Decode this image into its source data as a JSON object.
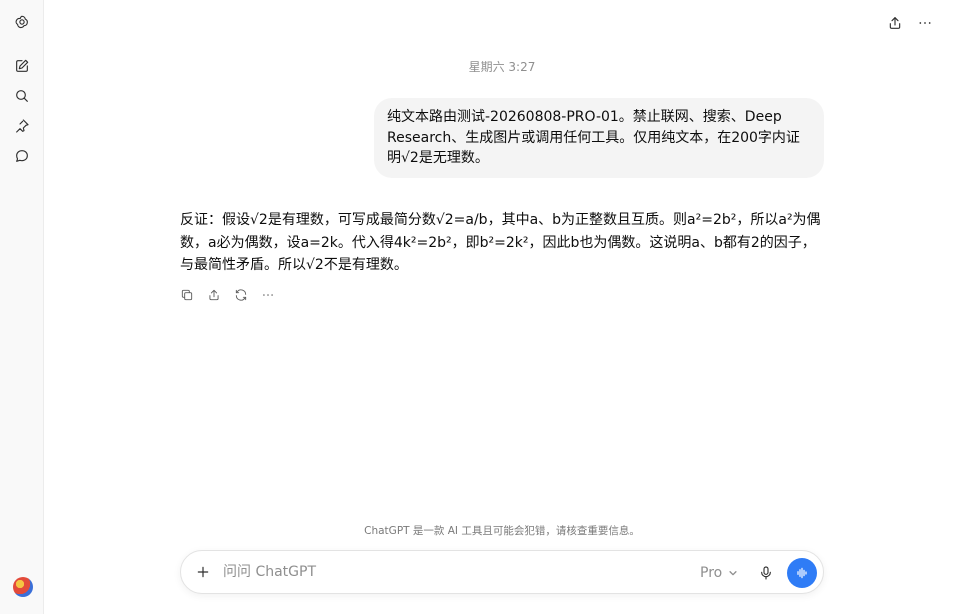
{
  "thread": {
    "timestamp": "星期六 3:27",
    "user_message": "纯文本路由测试-20260808-PRO-01。禁止联网、搜索、Deep Research、生成图片或调用任何工具。仅用纯文本，在200字内证明√2是无理数。",
    "assistant_message": "反证：假设√2是有理数，可写成最简分数√2=a/b，其中a、b为正整数且互质。则a²=2b²，所以a²为偶数，a必为偶数，设a=2k。代入得4k²=2b²，即b²=2k²，因此b也为偶数。这说明a、b都有2的因子，与最简性矛盾。所以√2不是有理数。"
  },
  "footer": {
    "disclaimer": "ChatGPT 是一款 AI 工具且可能会犯错，请核查重要信息。"
  },
  "composer": {
    "placeholder": "问问 ChatGPT",
    "model": "Pro"
  },
  "colors": {
    "accent": "#2f7cf6",
    "bubble_bg": "#f4f4f4",
    "sidebar_bg": "#f9f9f9"
  },
  "icons": {
    "sidebar": [
      "openai-logo-icon",
      "new-chat-icon",
      "search-icon",
      "pin-icon",
      "chat-bubble-icon"
    ],
    "topbar": [
      "share-icon",
      "more-icon"
    ],
    "message_actions": [
      "copy-icon",
      "share-icon",
      "regenerate-icon",
      "more-icon"
    ],
    "composer": [
      "plus-icon",
      "chevron-down-icon",
      "mic-icon",
      "voice-mode-icon"
    ]
  }
}
